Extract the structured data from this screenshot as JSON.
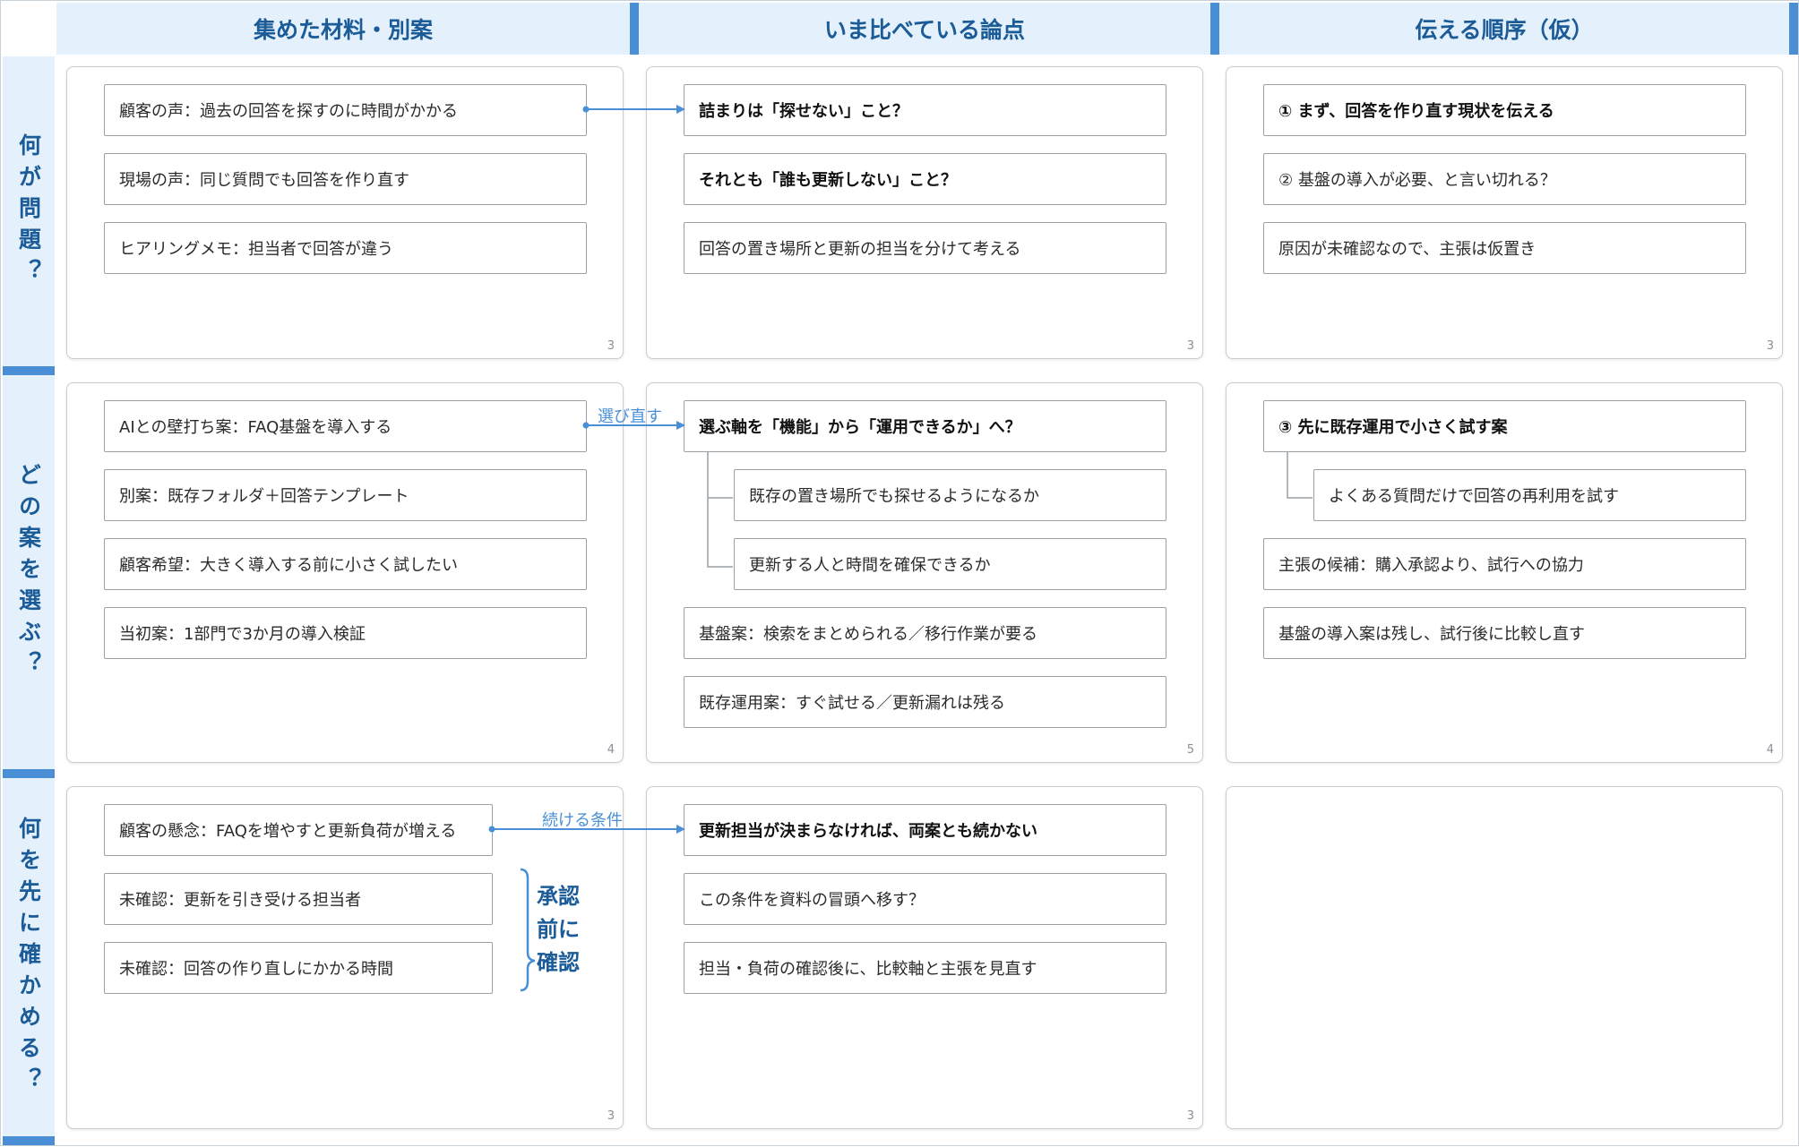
{
  "columns": [
    "集めた材料・別案",
    "いま比べている論点",
    "伝える順序（仮）"
  ],
  "rows": [
    "何が問題？",
    "どの案を選ぶ？",
    "何を先に確かめる？"
  ],
  "panels": {
    "r1c1": {
      "count": "3",
      "cards": [
        "顧客の声：過去の回答を探すのに時間がかかる",
        "現場の声：同じ質問でも回答を作り直す",
        "ヒアリングメモ：担当者で回答が違う"
      ]
    },
    "r1c2": {
      "count": "3",
      "cards": [
        "詰まりは「探せない」こと？",
        "それとも「誰も更新しない」こと？",
        "回答の置き場所と更新の担当を分けて考える"
      ]
    },
    "r1c3": {
      "count": "3",
      "cards": [
        "① まず、回答を作り直す現状を伝える",
        "② 基盤の導入が必要、と言い切れる？",
        "原因が未確認なので、主張は仮置き"
      ]
    },
    "r2c1": {
      "count": "4",
      "cards": [
        "AIとの壁打ち案：FAQ基盤を導入する",
        "別案：既存フォルダ＋回答テンプレート",
        "顧客希望：大きく導入する前に小さく試したい",
        "当初案：1部門で3か月の導入検証"
      ]
    },
    "r2c2": {
      "count": "5",
      "cards": [
        "選ぶ軸を「機能」から「運用できるか」へ？",
        "既存の置き場所でも探せるようになるか",
        "更新する人と時間を確保できるか",
        "基盤案：検索をまとめられる／移行作業が要る",
        "既存運用案：すぐ試せる／更新漏れは残る"
      ]
    },
    "r2c3": {
      "count": "4",
      "cards": [
        "③ 先に既存運用で小さく試す案",
        "よくある質問だけで回答の再利用を試す",
        "主張の候補：購入承認より、試行への協力",
        "基盤の導入案は残し、試行後に比較し直す"
      ]
    },
    "r3c1": {
      "count": "3",
      "cards": [
        "顧客の懸念：FAQを増やすと更新負荷が増える",
        "未確認：更新を引き受ける担当者",
        "未確認：回答の作り直しにかかる時間"
      ]
    },
    "r3c2": {
      "count": "3",
      "cards": [
        "更新担当が決まらなければ、両案とも続かない",
        "この条件を資料の冒頭へ移す？",
        "担当・負荷の確認後に、比較軸と主張を見直す"
      ]
    }
  },
  "connectors": {
    "row2": "選び直す",
    "row3": "続ける条件"
  },
  "approval_label": [
    "承認",
    "前に",
    "確認"
  ],
  "colors": {
    "accent": "#4a8fd6",
    "header_bg": "#e4f1fc",
    "header_text": "#1b5b97"
  }
}
